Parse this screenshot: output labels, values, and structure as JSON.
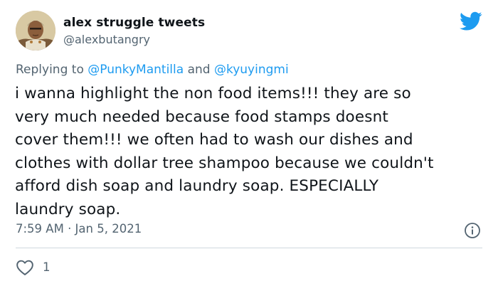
{
  "user": {
    "display_name": "alex struggle tweets",
    "handle": "@alexbutangry",
    "avatar_icon": "user-avatar"
  },
  "brand": {
    "logo_icon": "twitter-bird-icon",
    "color": "#1d9bf0"
  },
  "reply": {
    "prefix": "Replying to",
    "mention_1": "@PunkyMantilla",
    "joiner": "and",
    "mention_2": "@kyuyingmi"
  },
  "tweet": {
    "text": "i wanna highlight the non food items!!! they are so\nvery much needed because food stamps doesnt\ncover them!!! we often had to wash our dishes and\nclothes with dollar tree shampoo because we couldn't\nafford dish soap and laundry soap. ESPECIALLY\nlaundry soap.",
    "timestamp": "7:59 AM · Jan 5, 2021"
  },
  "actions": {
    "info_icon": "info-icon",
    "like_icon": "heart-icon",
    "like_count": "1"
  },
  "colors": {
    "text": "#0f1419",
    "secondary": "#536471",
    "divider": "#cfd9de"
  }
}
